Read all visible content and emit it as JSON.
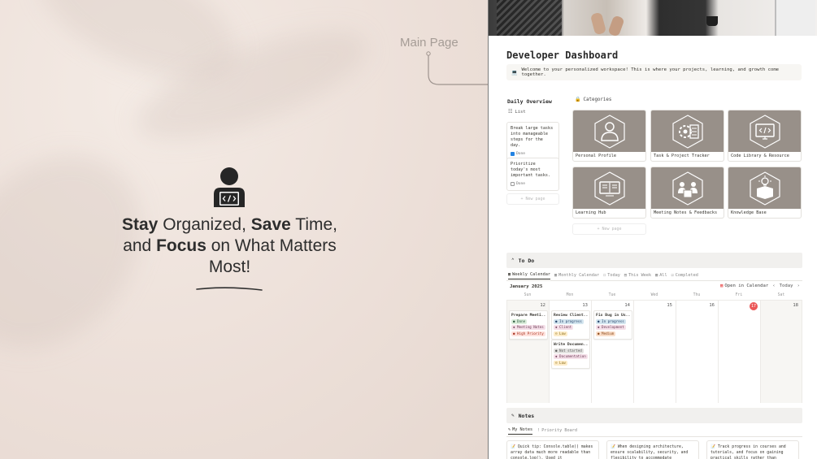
{
  "promo": {
    "main_page_label": "Main Page",
    "headline": {
      "w1": "Stay",
      "w2": " Organized, ",
      "w3": "Save",
      "w4": " Time, and ",
      "w5": "Focus",
      "w6": " on What Matters Most!"
    },
    "icon": "developer-icon"
  },
  "page": {
    "title": "Developer Dashboard",
    "welcome": "Welcome to your personalized workspace! This is where your projects, learning, and growth come together.",
    "daily_overview": {
      "title": "Daily Overview",
      "view_label": "List",
      "tasks": [
        {
          "text": "Break large tasks into manageable steps for the day.",
          "status": "Done",
          "checked": true
        },
        {
          "text": "Prioritize today's most important tasks.",
          "status": "Done",
          "checked": false
        }
      ],
      "new_page": "+ New page"
    },
    "categories": {
      "title": "Categories",
      "items": [
        {
          "label": "Personal Profile",
          "icon": "person-icon"
        },
        {
          "label": "Task & Project Tracker",
          "icon": "gear-list-icon"
        },
        {
          "label": "Code Library & Resource",
          "icon": "code-monitor-icon"
        },
        {
          "label": "Learning Hub",
          "icon": "book-icon"
        },
        {
          "label": "Meeting Notes & Feedbacks",
          "icon": "meeting-icon"
        },
        {
          "label": "Knowledge Base",
          "icon": "lightbulb-box-icon"
        }
      ],
      "new_page": "+ New page"
    },
    "todo": {
      "title": "To Do",
      "tabs": [
        "Weekly Calendar",
        "Monthly Calendar",
        "Today",
        "This Week",
        "All",
        "Completed"
      ],
      "month": "January 2025",
      "open_in_calendar": "Open in Calendar",
      "today_label": "Today",
      "days": [
        {
          "dow": "Sun",
          "num": "12"
        },
        {
          "dow": "Mon",
          "num": "13"
        },
        {
          "dow": "Tue",
          "num": "14"
        },
        {
          "dow": "Wed",
          "num": "15"
        },
        {
          "dow": "Thu",
          "num": "16"
        },
        {
          "dow": "Fri",
          "num": "17"
        },
        {
          "dow": "Sat",
          "num": "18"
        }
      ],
      "events": {
        "e1": {
          "title": "Prepare Meeti...",
          "tags": [
            "Done",
            "Meeting Notes",
            "High Priority"
          ]
        },
        "e2": {
          "title": "Review Client...",
          "tags": [
            "In progress",
            "Client",
            "Low"
          ]
        },
        "e3": {
          "title": "Fix Bug in Us...",
          "tags": [
            "In progress",
            "Development",
            "Medium"
          ]
        },
        "e4": {
          "title": "Write Documen...",
          "tags": [
            "Not started",
            "Documentation",
            "Low"
          ]
        }
      }
    },
    "notes": {
      "title": "Notes",
      "tabs": [
        "My Notes",
        "Priority Board"
      ],
      "cards": [
        "Quick tip: Console.table() makes array data much more readable than console.log(). Used it",
        "When designing architecture, ensure scalability, security, and flexibility to accommodate",
        "Track progress in courses and tutorials, and focus on gaining practical skills rather than"
      ]
    }
  }
}
